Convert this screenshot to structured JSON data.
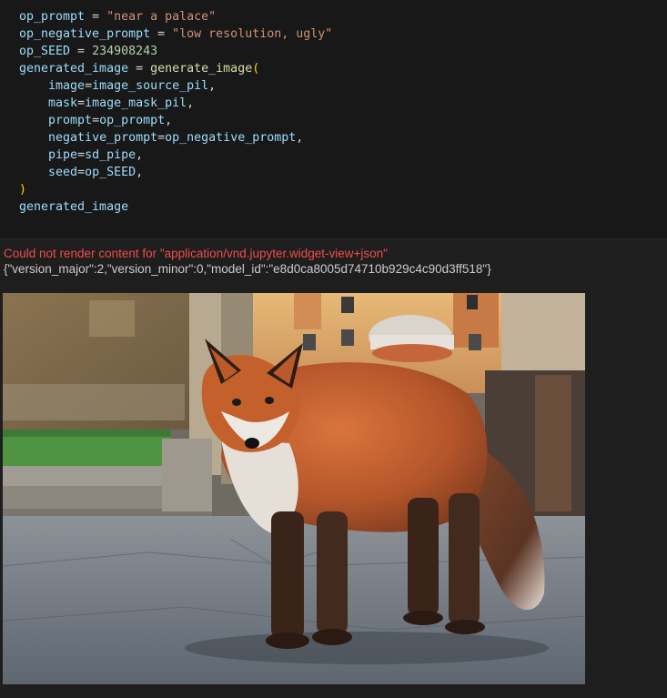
{
  "code_cell": {
    "lines": [
      {
        "var": "op_prompt",
        "eq": " = ",
        "str": "\"near a palace\""
      },
      {
        "var": "op_negative_prompt",
        "eq": " = ",
        "str": "\"low resolution, ugly\""
      },
      {
        "var": "op_SEED",
        "eq": " = ",
        "num": "234908243"
      },
      {
        "var": "generated_image",
        "eq": " = ",
        "fn": "generate_image",
        "paren": "("
      },
      {
        "indent": "    ",
        "kw": "image",
        "eq": "=",
        "val": "image_source_pil",
        "comma": ","
      },
      {
        "indent": "    ",
        "kw": "mask",
        "eq": "=",
        "val": "image_mask_pil",
        "comma": ","
      },
      {
        "indent": "    ",
        "kw": "prompt",
        "eq": "=",
        "val": "op_prompt",
        "comma": ","
      },
      {
        "indent": "    ",
        "kw": "negative_prompt",
        "eq": "=",
        "val": "op_negative_prompt",
        "comma": ","
      },
      {
        "indent": "    ",
        "kw": "pipe",
        "eq": "=",
        "val": "sd_pipe",
        "comma": ","
      },
      {
        "indent": "    ",
        "kw": "seed",
        "eq": "=",
        "val": "op_SEED",
        "comma": ","
      },
      {
        "paren": ")"
      },
      {
        "var": "generated_image"
      }
    ]
  },
  "output": {
    "error_text": "Could not render content for \"application/vnd.jupyter.widget-view+json\"",
    "json_text": "{\"version_major\":2,\"version_minor\":0,\"model_id\":\"e8d0ca8005d74710b929c4c90d3ff518\"}"
  },
  "colors": {
    "variable": "#9cdcfe",
    "string": "#ce9178",
    "number": "#b5cea8",
    "function": "#dcdcaa",
    "bracket": "#ffd700",
    "error": "#f14c4c"
  }
}
